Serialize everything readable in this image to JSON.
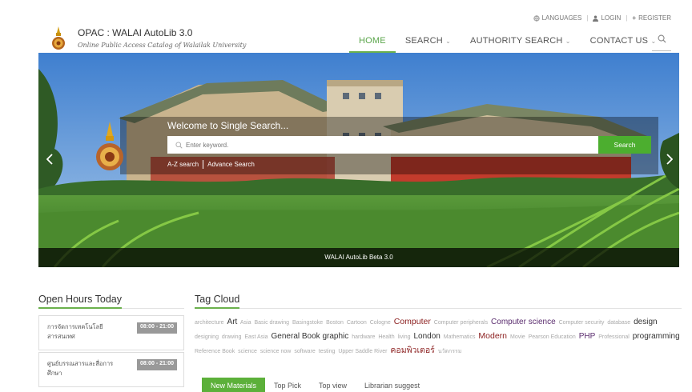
{
  "topbar": {
    "languages": "LANGUAGES",
    "login": "LOGIN",
    "register": "REGISTER"
  },
  "brand": {
    "title": "OPAC : WALAI AutoLib 3.0",
    "subtitle": "Online Public Access Catalog of Walailak University"
  },
  "nav": {
    "home": "HOME",
    "search": "SEARCH",
    "authority": "AUTHORITY SEARCH",
    "contact": "CONTACT US"
  },
  "hero": {
    "welcome": "Welcome to Single Search...",
    "placeholder": "Enter keyword.",
    "search_button": "Search",
    "az_link": "A-Z search",
    "advance_link": "Advance Search",
    "caption": "WALAI AutoLib Beta 3.0"
  },
  "open_hours": {
    "title": "Open Hours Today",
    "items": [
      {
        "name": "การจัดการเทคโนโลยีสารสนเทศ",
        "time": "08:00 - 21:00"
      },
      {
        "name": "ศูนย์บรรณสารและสื่อการศึกษา",
        "time": "08:00 - 21:00"
      }
    ]
  },
  "tag_cloud": {
    "title": "Tag Cloud",
    "tags": [
      {
        "text": "architecture",
        "size": "s1"
      },
      {
        "text": "Art",
        "size": "s3"
      },
      {
        "text": "Asia",
        "size": "s1"
      },
      {
        "text": "Basic drawing",
        "size": "s1"
      },
      {
        "text": "Basingstoke",
        "size": "s1"
      },
      {
        "text": "Boston",
        "size": "s1"
      },
      {
        "text": "Cartoon",
        "size": "s1"
      },
      {
        "text": "Cologne",
        "size": "s1"
      },
      {
        "text": "Computer",
        "size": "red"
      },
      {
        "text": "Computer peripherals",
        "size": "s1"
      },
      {
        "text": "Computer science",
        "size": "purple"
      },
      {
        "text": "Computer security",
        "size": "s1"
      },
      {
        "text": "database",
        "size": "s1"
      },
      {
        "text": "design",
        "size": "s3"
      },
      {
        "text": "designing",
        "size": "s1"
      },
      {
        "text": "drawing",
        "size": "s1"
      },
      {
        "text": "East Asia",
        "size": "s1"
      },
      {
        "text": "General Book graphic",
        "size": "s3"
      },
      {
        "text": "hardware",
        "size": "s1"
      },
      {
        "text": "Health",
        "size": "s1"
      },
      {
        "text": "living",
        "size": "s1"
      },
      {
        "text": "London",
        "size": "s3"
      },
      {
        "text": "Mathematics",
        "size": "s1"
      },
      {
        "text": "Modern",
        "size": "red"
      },
      {
        "text": "Movie",
        "size": "s1"
      },
      {
        "text": "Pearson Education",
        "size": "s1"
      },
      {
        "text": "PHP",
        "size": "purple"
      },
      {
        "text": "Professional",
        "size": "s1"
      },
      {
        "text": "programming",
        "size": "s3"
      },
      {
        "text": "Reference Book",
        "size": "s1"
      },
      {
        "text": "science",
        "size": "s1"
      },
      {
        "text": "science now",
        "size": "s1"
      },
      {
        "text": "software",
        "size": "s1"
      },
      {
        "text": "testing",
        "size": "s1"
      },
      {
        "text": "Upper Saddle River",
        "size": "s1"
      },
      {
        "text": "คอมพิวเตอร์",
        "size": "red"
      },
      {
        "text": "นวัตกรรม",
        "size": "s1"
      }
    ]
  },
  "tabs": [
    "New Materials",
    "Top Pick",
    "Top view",
    "Librarian suggest"
  ],
  "colors": {
    "accent": "#5cb03a",
    "tag_red": "#8b1e1e",
    "tag_purple": "#5a2c6e"
  }
}
